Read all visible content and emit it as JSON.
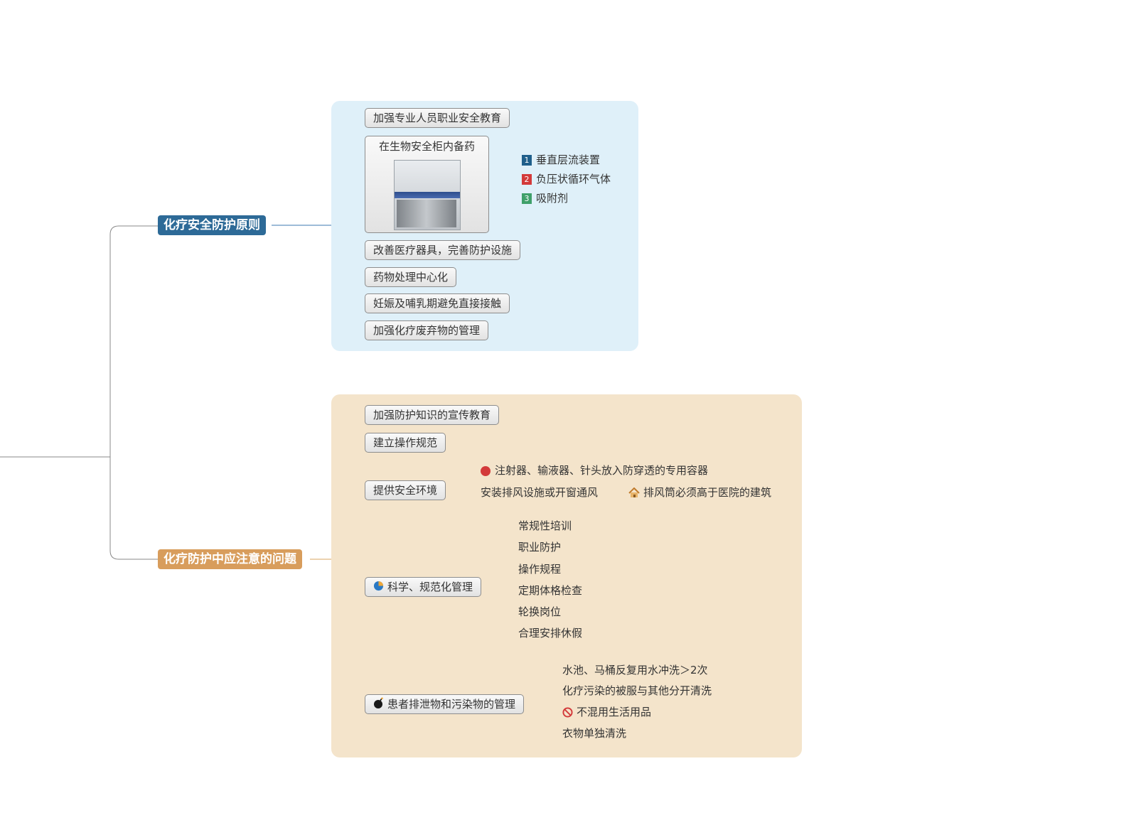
{
  "main_topics": [
    {
      "label": "化疗安全防护原则",
      "children": [
        {
          "label": "加强专业人员职业安全教育"
        },
        {
          "label": "在生物安全柜内备药",
          "image": "biosafety-cabinet",
          "children": [
            {
              "label": "垂直层流装置",
              "marker": "1",
              "marker_color": "#1f5f8b"
            },
            {
              "label": "负压状循环气体",
              "marker": "2",
              "marker_color": "#d33a3a"
            },
            {
              "label": "吸附剂",
              "marker": "3",
              "marker_color": "#3fa06a"
            }
          ]
        },
        {
          "label": "改善医疗器具，完善防护设施"
        },
        {
          "label": "药物处理中心化"
        },
        {
          "label": "妊娠及哺乳期避免直接接触"
        },
        {
          "label": "加强化疗废弃物的管理"
        }
      ]
    },
    {
      "label": "化疗防护中应注意的问题",
      "children": [
        {
          "label": "加强防护知识的宣传教育"
        },
        {
          "label": "建立操作规范"
        },
        {
          "label": "提供安全环境",
          "children": [
            {
              "label": "注射器、输液器、针头放入防穿透的专用容器",
              "icon": "syringe-icon"
            },
            {
              "label": "安装排风设施或开窗通风",
              "children": [
                {
                  "label": "排风筒必须高于医院的建筑",
                  "icon": "house-icon"
                }
              ]
            }
          ]
        },
        {
          "label": "科学、规范化管理",
          "icon": "pie-chart-icon",
          "children": [
            {
              "label": "常规性培训"
            },
            {
              "label": "职业防护"
            },
            {
              "label": "操作规程"
            },
            {
              "label": "定期体格检查"
            },
            {
              "label": "轮换岗位"
            },
            {
              "label": "合理安排休假"
            }
          ]
        },
        {
          "label": "患者排泄物和污染物的管理",
          "icon": "bomb-icon",
          "children": [
            {
              "label": "水池、马桶反复用水冲洗＞2次"
            },
            {
              "label": "化疗污染的被服与其他分开清洗"
            },
            {
              "label": "不混用生活用品",
              "icon": "prohibited-icon"
            },
            {
              "label": "衣物单独清洗"
            }
          ]
        }
      ]
    }
  ],
  "colors": {
    "blue_region": "#dff0f9",
    "tan_region": "#f4e4cb",
    "blue_topic": "#2d6a97",
    "tan_topic": "#d89d5c",
    "blue_line": "#3b7ab0",
    "tan_line": "#d9a55f",
    "root_line": "#888888"
  }
}
